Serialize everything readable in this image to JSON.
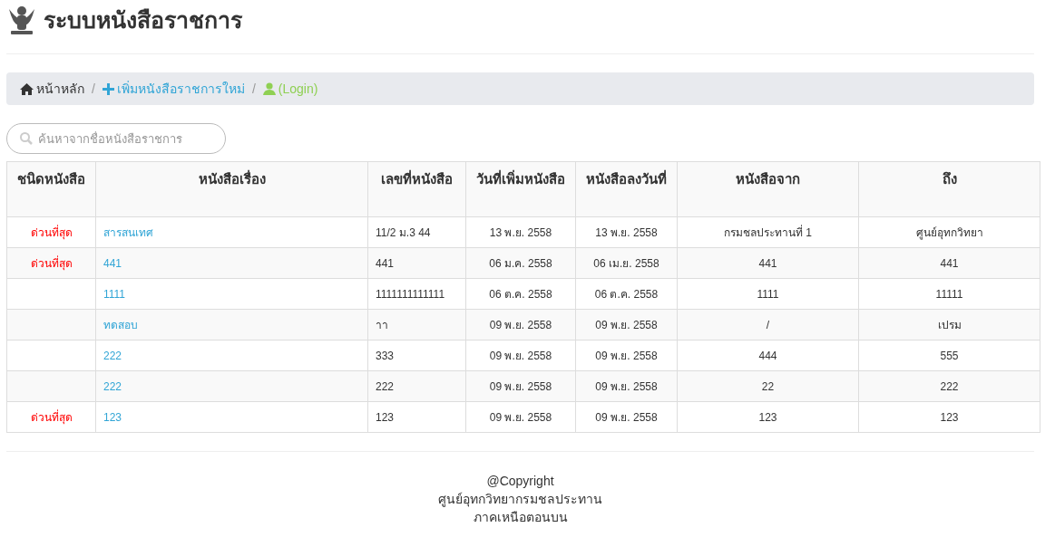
{
  "header": {
    "title": "ระบบหนังสือราชการ"
  },
  "breadcrumb_separator": "/",
  "breadcrumb": [
    {
      "label": "หน้าหลัก",
      "kind": "home"
    },
    {
      "label": "เพิ่มหนังสือราชการใหม่",
      "kind": "add"
    },
    {
      "label": "(Login)",
      "kind": "login"
    }
  ],
  "search": {
    "placeholder": "ค้นหาจากชื่อหนังสือราชการ"
  },
  "table": {
    "columns": [
      "ชนิดหนังสือ",
      "หนังสือเรื่อง",
      "เลขที่หนังสือ",
      "วันที่เพิ่มหนังสือ",
      "หนังสือลงวันที่",
      "หนังสือจาก",
      "ถึง"
    ],
    "rows": [
      {
        "type": "ด่วนที่สุด",
        "subject": "สารสนเทศ",
        "number": "11/2 ม.3 44",
        "added": "13 พ.ย. 2558",
        "dated": "13 พ.ย. 2558",
        "from": "กรมชลประทานที่ 1",
        "to": "ศูนย์อุทกวิทยา"
      },
      {
        "type": "ด่วนที่สุด",
        "subject": "441",
        "number": "441",
        "added": "06 ม.ค. 2558",
        "dated": "06 เม.ย. 2558",
        "from": "441",
        "to": "441"
      },
      {
        "subject": "1111",
        "number": "1111111111111",
        "added": "06 ต.ค. 2558",
        "dated": "06 ต.ค. 2558",
        "from": "1111",
        "to": "11111"
      },
      {
        "subject": "ทดสอบ",
        "number": "าา",
        "added": "09 พ.ย. 2558",
        "dated": "09 พ.ย. 2558",
        "from": "/",
        "to": "เปรม"
      },
      {
        "subject": "222",
        "number": "333",
        "added": "09 พ.ย. 2558",
        "dated": "09 พ.ย. 2558",
        "from": "444",
        "to": "555"
      },
      {
        "subject": "222",
        "number": "222",
        "added": "09 พ.ย. 2558",
        "dated": "09 พ.ย. 2558",
        "from": "22",
        "to": "222"
      },
      {
        "type": "ด่วนที่สุด",
        "subject": "123",
        "number": "123",
        "added": "09 พ.ย. 2558",
        "dated": "09 พ.ย. 2558",
        "from": "123",
        "to": "123"
      }
    ]
  },
  "footer": [
    "@Copyright",
    "ศูนย์อุทกวิทยากรมชลประทาน",
    "ภาคเหนือตอนบน"
  ]
}
